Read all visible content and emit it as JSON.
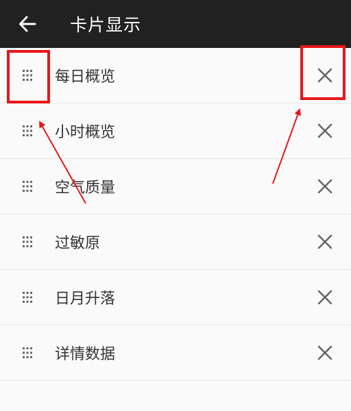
{
  "app_bar": {
    "title": "卡片显示",
    "back_icon": "arrow-left-icon"
  },
  "cards": {
    "items": [
      {
        "label": "每日概览"
      },
      {
        "label": "小时概览"
      },
      {
        "label": "空气质量"
      },
      {
        "label": "过敏原"
      },
      {
        "label": "日月升落"
      },
      {
        "label": "详情数据"
      }
    ],
    "drag_icon": "drag-handle-icon",
    "remove_icon": "close-icon"
  },
  "colors": {
    "app_bar_bg": "#212121",
    "page_bg": "#fafafa",
    "annotation": "#e8161a",
    "icon": "#666666"
  }
}
